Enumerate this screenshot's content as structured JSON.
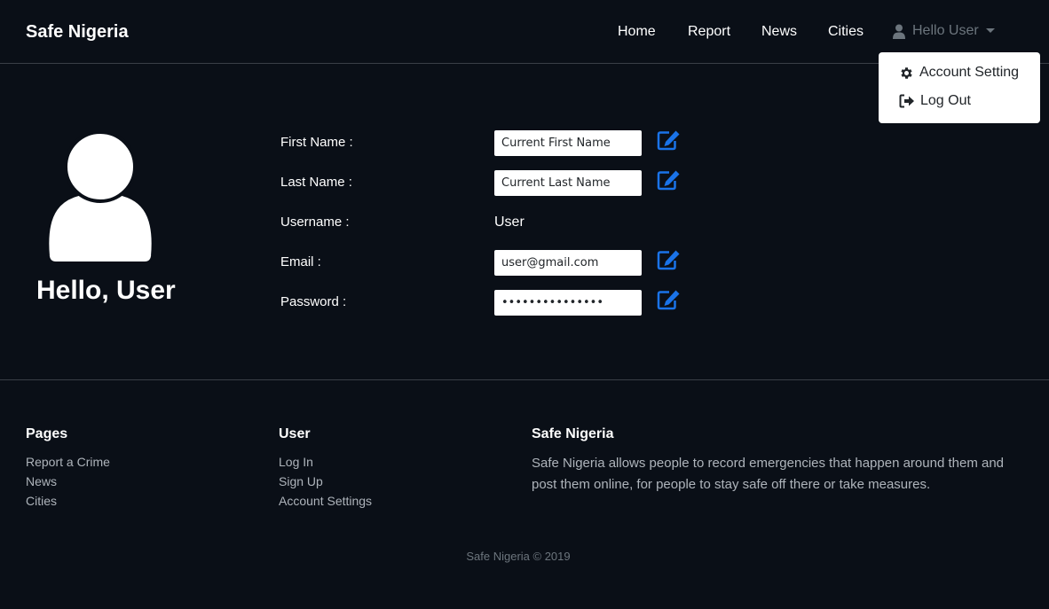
{
  "navbar": {
    "brand": "Safe Nigeria",
    "links": [
      "Home",
      "Report",
      "News",
      "Cities"
    ],
    "user_label": "Hello User",
    "dropdown": {
      "account_setting": "Account Setting",
      "log_out": "Log Out"
    }
  },
  "profile": {
    "greeting": "Hello, User",
    "fields": {
      "first_name": {
        "label": "First Name :",
        "value": "Current First Name"
      },
      "last_name": {
        "label": "Last Name :",
        "value": "Current Last Name"
      },
      "username": {
        "label": "Username :",
        "value": "User"
      },
      "email": {
        "label": "Email :",
        "value": "user@gmail.com"
      },
      "password": {
        "label": "Password :",
        "value": "passwordpasswor"
      }
    }
  },
  "footer": {
    "pages": {
      "heading": "Pages",
      "links": [
        "Report a Crime",
        "News",
        "Cities"
      ]
    },
    "user": {
      "heading": "User",
      "links": [
        "Log In",
        "Sign Up",
        "Account Settings"
      ]
    },
    "about": {
      "heading": "Safe Nigeria",
      "text": "Safe Nigeria allows people to record emergencies that happen around them and post them online, for people to stay safe off there or take measures."
    },
    "copyright": "Safe Nigeria © 2019"
  },
  "colors": {
    "background": "#0a0f17",
    "accent": "#1a73e8",
    "muted": "#6c757d"
  },
  "icons": {
    "user": "user-icon",
    "gear": "gear-icon",
    "logout": "sign-out-icon",
    "edit": "edit-icon"
  }
}
